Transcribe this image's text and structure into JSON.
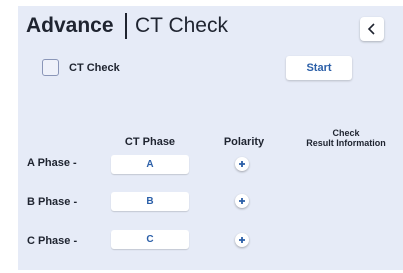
{
  "header": {
    "title_bold": "Advance",
    "title_regular": "CT Check"
  },
  "controls": {
    "checkbox_label": "CT Check",
    "checkbox_checked": false,
    "start_label": "Start"
  },
  "columns": {
    "ct_phase": "CT Phase",
    "polarity": "Polarity",
    "check_line1": "Check",
    "check_line2": "Result Information"
  },
  "rows": [
    {
      "label": "A Phase -",
      "phase": "A",
      "polarity_icon": "plus-icon"
    },
    {
      "label": "B Phase -",
      "phase": "B",
      "polarity_icon": "plus-icon"
    },
    {
      "label": "C Phase -",
      "phase": "C",
      "polarity_icon": "plus-icon"
    }
  ],
  "colors": {
    "panel_bg": "#e6ebf7",
    "accent": "#2b5fa8",
    "text": "#1f2430"
  }
}
